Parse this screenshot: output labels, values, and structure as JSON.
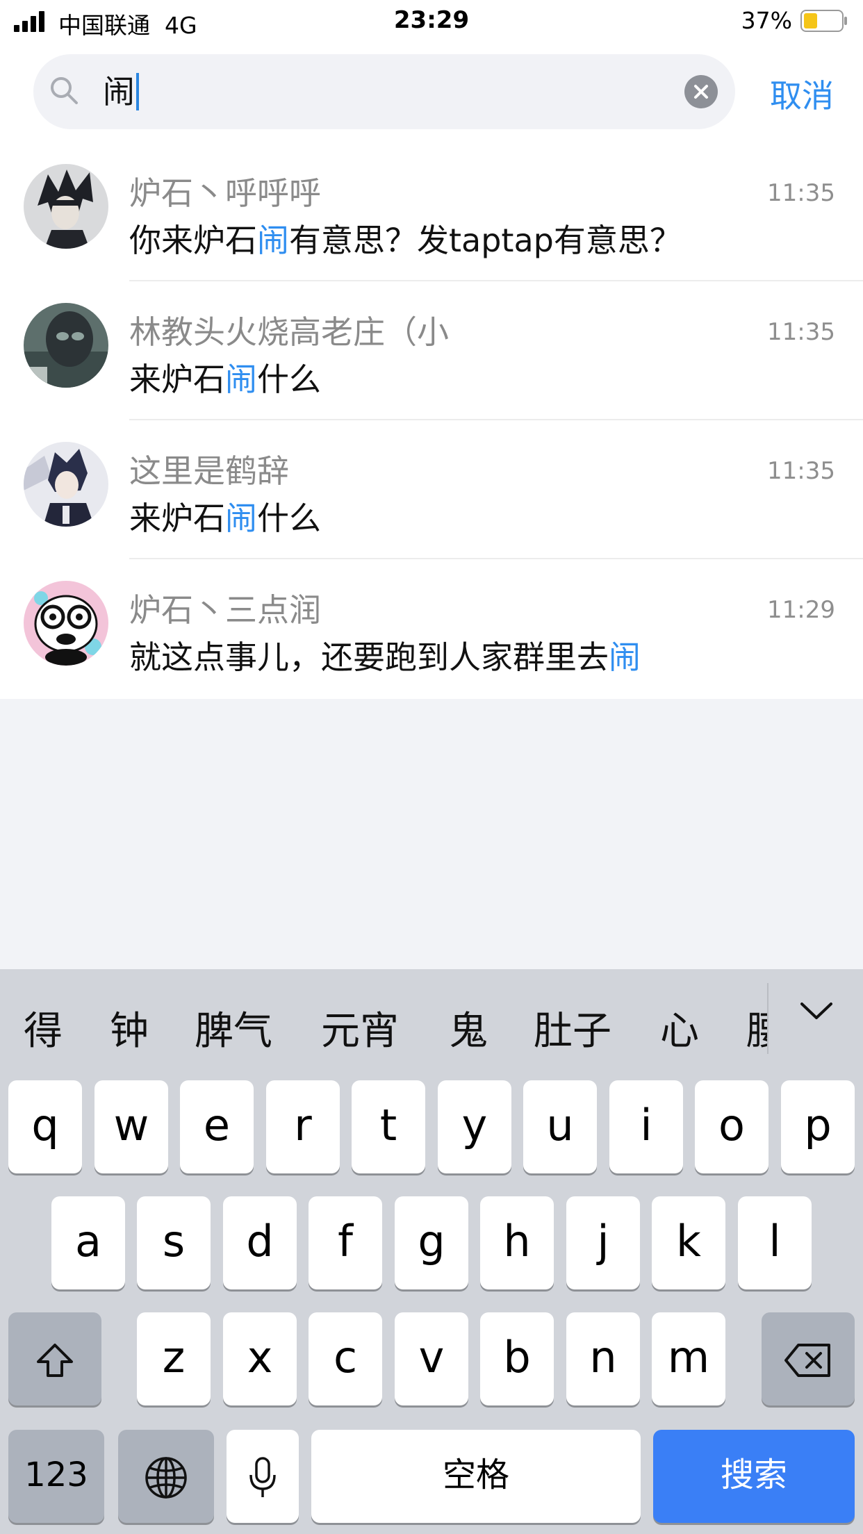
{
  "status_bar": {
    "carrier": "中国联通",
    "network": "4G",
    "time": "23:29",
    "battery": "37%",
    "battery_level": 0.37
  },
  "search": {
    "query": "闹",
    "cancel_label": "取消"
  },
  "results": [
    {
      "name": "炉石丶呼呼呼",
      "msg_before": "你来炉石",
      "msg_match": "闹",
      "msg_after": "有意思？发taptap有意思？",
      "time": "11:35"
    },
    {
      "name": "林教头火烧高老庄（小",
      "msg_before": "来炉石",
      "msg_match": "闹",
      "msg_after": "什么",
      "time": "11:35"
    },
    {
      "name": "这里是鹤辞",
      "msg_before": "来炉石",
      "msg_match": "闹",
      "msg_after": "什么",
      "time": "11:35"
    },
    {
      "name": "炉石丶三点润",
      "msg_before": "就这点事儿，还要跑到人家群里去",
      "msg_match": "闹",
      "msg_after": "",
      "time": "11:29"
    }
  ],
  "keyboard": {
    "candidates": [
      "得",
      "钟",
      "脾气",
      "元宵",
      "鬼",
      "肚子",
      "心",
      "腰"
    ],
    "row1": [
      "q",
      "w",
      "e",
      "r",
      "t",
      "y",
      "u",
      "i",
      "o",
      "p"
    ],
    "row2": [
      "a",
      "s",
      "d",
      "f",
      "g",
      "h",
      "j",
      "k",
      "l"
    ],
    "row3": [
      "z",
      "x",
      "c",
      "v",
      "b",
      "n",
      "m"
    ],
    "numbers_label": "123",
    "space_label": "空格",
    "search_label": "搜索"
  },
  "colors": {
    "accent": "#2f8ef0",
    "search_key": "#3a7ff6"
  }
}
